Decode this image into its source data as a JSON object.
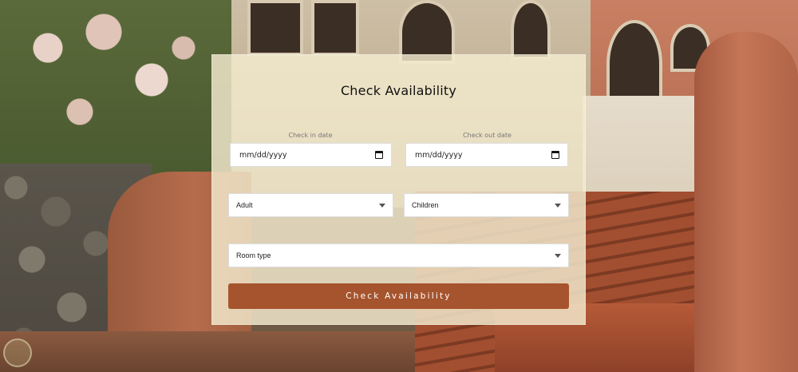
{
  "form": {
    "title": "Check Availability",
    "check_in": {
      "label": "Check in date",
      "placeholder": "mm/dd/yyyy"
    },
    "check_out": {
      "label": "Check out date",
      "placeholder": "mm/dd/yyyy"
    },
    "adult": {
      "value": "Adult"
    },
    "children": {
      "value": "Children"
    },
    "room_type": {
      "value": "Room type"
    },
    "submit_label": "Check Availability"
  },
  "icons": {
    "date_picker": "calendar-icon",
    "dropdown": "chevron-down-icon"
  },
  "colors": {
    "accent": "#a6542e",
    "card_background": "#f4ecd0"
  }
}
